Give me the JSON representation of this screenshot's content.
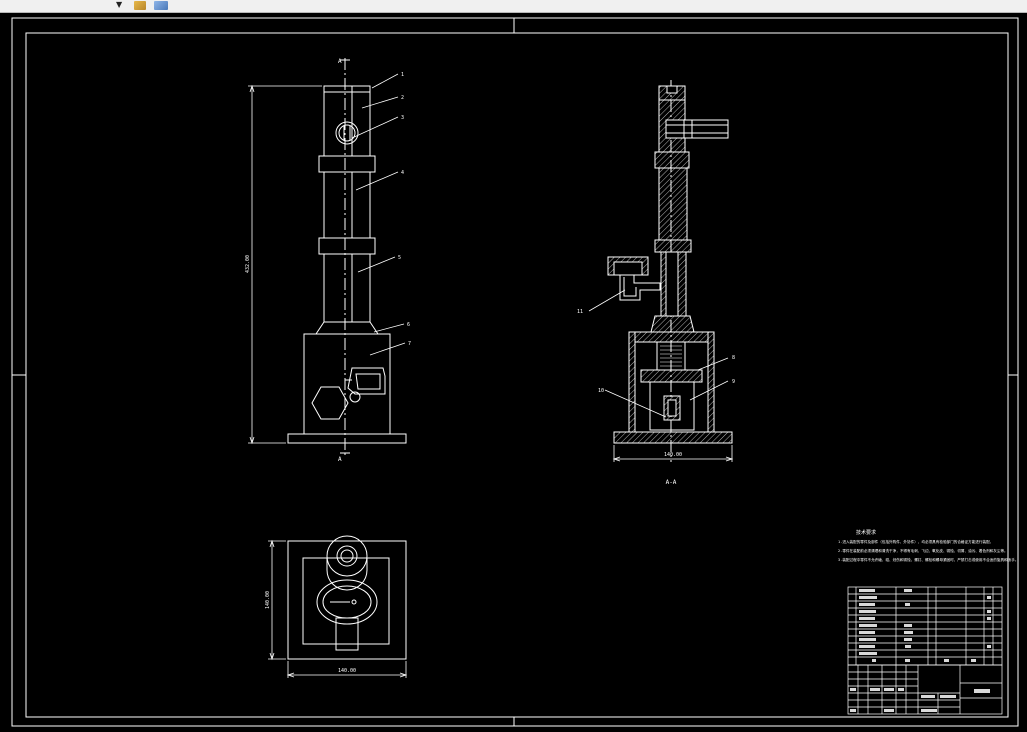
{
  "drawing": {
    "front_view": {
      "section_mark_top": "A",
      "section_mark_bottom": "A",
      "height_dim": "432.00",
      "balloons": [
        "1",
        "2",
        "3",
        "4",
        "5",
        "6",
        "7"
      ]
    },
    "section_view": {
      "title": "A-A",
      "width_dim": "140.00",
      "balloons": [
        "8",
        "9",
        "10",
        "11"
      ]
    },
    "top_view": {
      "width_dim": "140.00",
      "height_dim": "140.00"
    },
    "notes": {
      "title": "技术要求",
      "lines": [
        "1.进入装配的零件及部件（包括外购件、外协件），均必须具有检验部门的合格证方能进行装配。",
        "2.零件在装配前必须清理和清洗干净，不得有毛刺、飞边、氧化皮、锈蚀、切屑、油污、着色剂和灰尘等。",
        "3.装配过程中零件不允许磕、碰、划伤和锈蚀，螺钉、螺栓和螺母紧固时，严禁打击或使用不合适的旋具和扳手。"
      ]
    }
  },
  "colors": {
    "background": "#000000",
    "lines": "#ffffff",
    "toolbar": "#f0f0f0"
  }
}
